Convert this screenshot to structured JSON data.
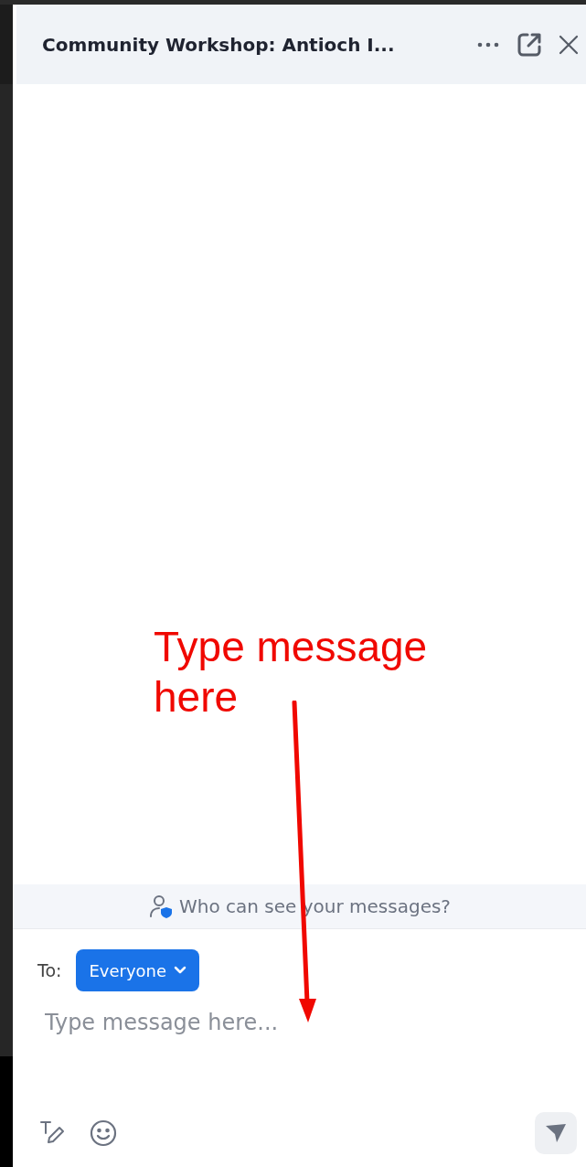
{
  "header": {
    "title": "Community Workshop: Antioch I..."
  },
  "privacy_notice": "Who can see your messages?",
  "compose": {
    "to_label": "To:",
    "recipient": "Everyone",
    "placeholder": "Type message here..."
  },
  "annotation": {
    "text": "Type message here"
  }
}
